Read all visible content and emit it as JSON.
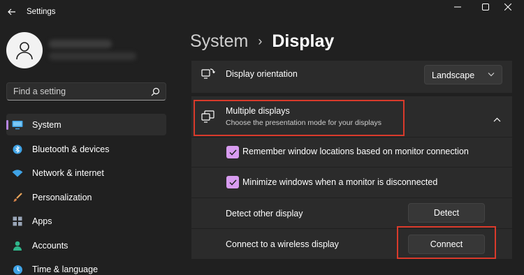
{
  "app": {
    "title": "Settings"
  },
  "search": {
    "placeholder": "Find a setting"
  },
  "sidebar": {
    "items": [
      {
        "label": "System",
        "icon": "monitor-icon",
        "active": true
      },
      {
        "label": "Bluetooth & devices",
        "icon": "bluetooth-icon"
      },
      {
        "label": "Network & internet",
        "icon": "wifi-icon"
      },
      {
        "label": "Personalization",
        "icon": "brush-icon"
      },
      {
        "label": "Apps",
        "icon": "apps-icon"
      },
      {
        "label": "Accounts",
        "icon": "person-icon"
      },
      {
        "label": "Time & language",
        "icon": "globe-clock-icon"
      }
    ]
  },
  "breadcrumb": {
    "root": "System",
    "separator": "›",
    "current": "Display"
  },
  "display_orientation": {
    "label": "Display orientation",
    "value": "Landscape"
  },
  "multiple_displays": {
    "title": "Multiple displays",
    "description": "Choose the presentation mode for your displays"
  },
  "options": {
    "remember_locations": {
      "label": "Remember window locations based on monitor connection",
      "checked": true
    },
    "minimize_windows": {
      "label": "Minimize windows when a monitor is disconnected",
      "checked": true
    },
    "detect": {
      "label": "Detect other display",
      "button": "Detect"
    },
    "connect": {
      "label": "Connect to a wireless display",
      "button": "Connect"
    }
  },
  "colors": {
    "accent": "#d89cf0",
    "highlight": "#d93a2b",
    "background": "#202020",
    "card": "#2b2b2b"
  }
}
